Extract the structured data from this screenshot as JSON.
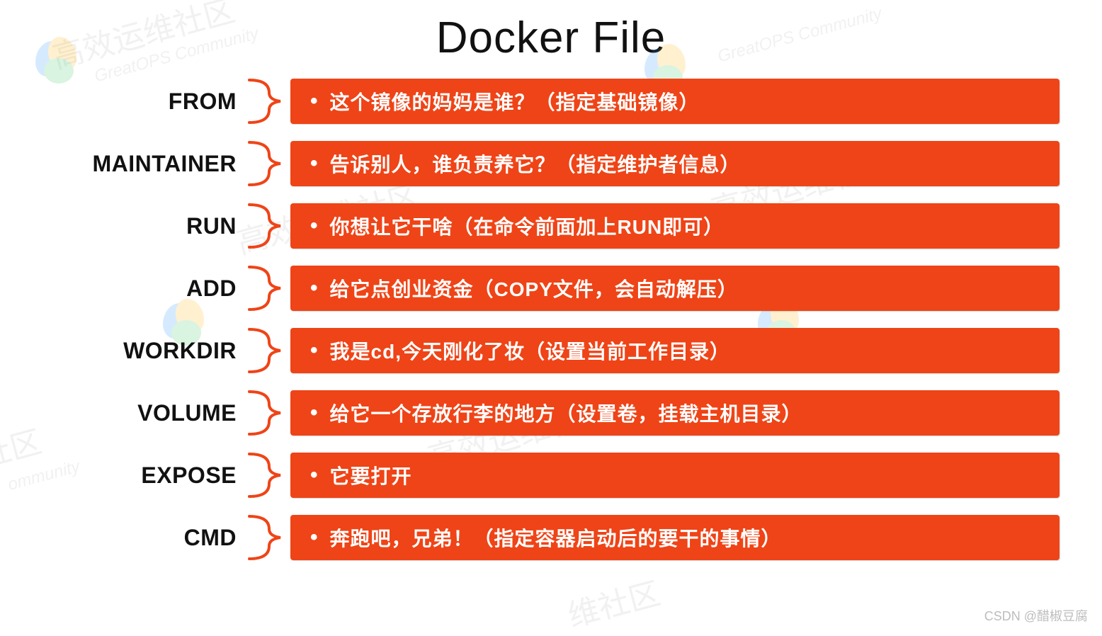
{
  "title": "Docker File",
  "rows": [
    {
      "label": "FROM",
      "desc": "这个镜像的妈妈是谁？（指定基础镜像）"
    },
    {
      "label": "MAINTAINER",
      "desc": "告诉别人，谁负责养它？（指定维护者信息）"
    },
    {
      "label": "RUN",
      "desc": "你想让它干啥（在命令前面加上RUN即可）"
    },
    {
      "label": "ADD",
      "desc": "给它点创业资金（COPY文件，会自动解压）"
    },
    {
      "label": "WORKDIR",
      "desc": "我是cd,今天刚化了妆（设置当前工作目录）"
    },
    {
      "label": "VOLUME",
      "desc": "给它一个存放行李的地方（设置卷，挂载主机目录）"
    },
    {
      "label": "EXPOSE",
      "desc": "它要打开"
    },
    {
      "label": "CMD",
      "desc": "奔跑吧，兄弟！（指定容器启动后的要干的事情）"
    }
  ],
  "watermarks": {
    "big": "高效运维社区",
    "small": "GreatOPS Community"
  },
  "attribution": "CSDN @醋椒豆腐"
}
